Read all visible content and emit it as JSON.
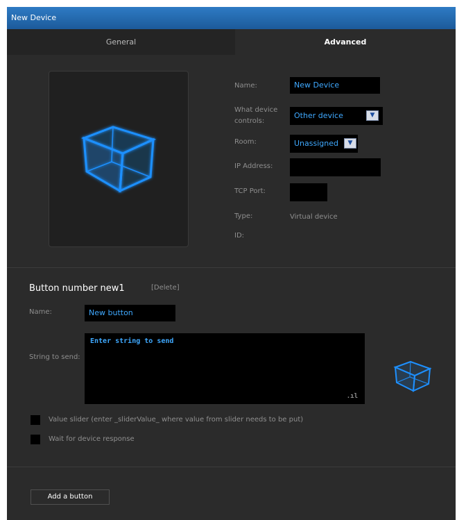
{
  "window": {
    "title": "New Device"
  },
  "tabs": [
    {
      "label": "General"
    },
    {
      "label": "Advanced"
    }
  ],
  "device": {
    "name_label": "Name:",
    "name_value": "New Device",
    "controls_label": "What device controls:",
    "controls_value": "Other device",
    "room_label": "Room:",
    "room_value": "Unassigned",
    "ip_label": "IP Address:",
    "ip_value": "",
    "port_label": "TCP Port:",
    "port_value": "",
    "type_label": "Type:",
    "type_value": "Virtual device",
    "id_label": "ID:"
  },
  "button_section": {
    "title": "Button number new1",
    "delete_label": "[Delete]",
    "name_label": "Name:",
    "name_value": "New button",
    "string_label": "String to send:",
    "string_value": "Enter string to send",
    "value_slider_label": "Value slider (enter _sliderValue_ where value from slider needs to be put)",
    "wait_label": "Wait for device response"
  },
  "footer": {
    "add_button_label": "Add a button"
  },
  "icons": {
    "device_preview": "cube-icon",
    "button_preview": "cube-icon",
    "dropdown": "chevron-down-icon"
  },
  "colors": {
    "titlebar": "#2e7bc4",
    "accent_text": "#3fa9ff",
    "cube": "#1e90ff"
  }
}
